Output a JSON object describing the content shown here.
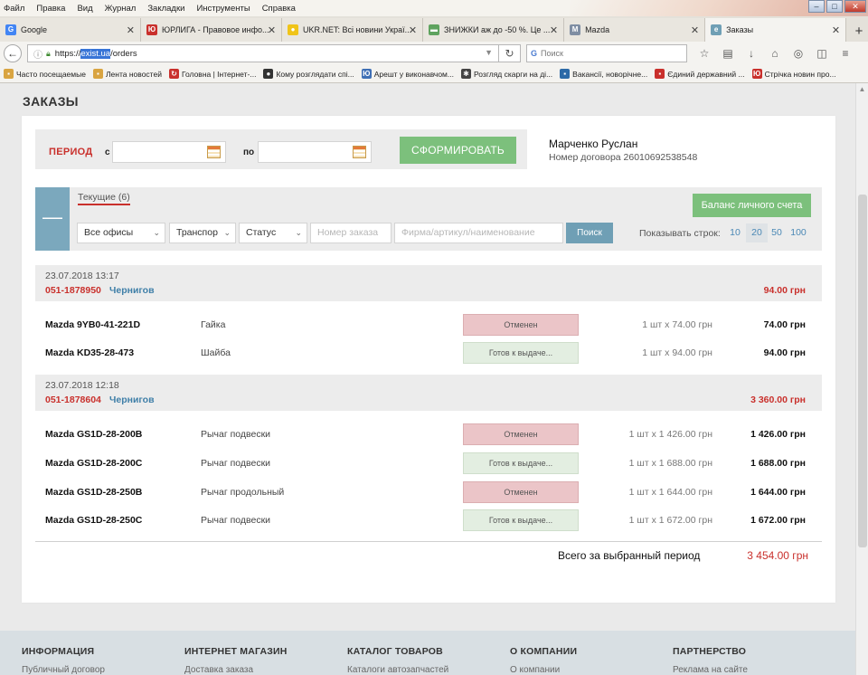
{
  "browser": {
    "menu": [
      "Файл",
      "Правка",
      "Вид",
      "Журнал",
      "Закладки",
      "Инструменты",
      "Справка"
    ],
    "tabs": [
      {
        "title": "Google",
        "icon": "google-icon",
        "color": "#4285f4"
      },
      {
        "title": "ЮРЛИГА - Правовое инфо...",
        "icon": "yurliga-icon",
        "color": "#c9302c"
      },
      {
        "title": "UKR.NET: Всі новини Украї...",
        "icon": "ukrnet-icon",
        "color": "#f0c419"
      },
      {
        "title": "ЗНИЖКИ аж до -50 %. Це ...",
        "icon": "sale-icon",
        "color": "#5fa35f"
      },
      {
        "title": "Mazda",
        "icon": "mazda-icon",
        "color": "#7f8ea3"
      },
      {
        "title": "Заказы",
        "icon": "exist-icon",
        "color": "#6f9fb5"
      }
    ],
    "url_prefix": "https://",
    "url_highlight": "exist.ua",
    "url_suffix": "/orders",
    "search_placeholder": "Поиск",
    "bookmarks": [
      {
        "label": "Часто посещаемые",
        "color": "#d9a441"
      },
      {
        "label": "Лента новостей",
        "color": "#d9a441"
      },
      {
        "label": "Головна | Інтернет-...",
        "color": "#c9302c"
      },
      {
        "label": "Кому розглядати спі...",
        "color": "#333333"
      },
      {
        "label": "Арешт у виконавчом...",
        "color": "#3f6fb5"
      },
      {
        "label": "Розгляд скарги на ді...",
        "color": "#444444"
      },
      {
        "label": "Вакансії, новорічне...",
        "color": "#2d6aa7"
      },
      {
        "label": "Єдиний державний ...",
        "color": "#c9302c"
      },
      {
        "label": "Стрічка новин про...",
        "color": "#c9302c"
      }
    ]
  },
  "page": {
    "title": "ЗАКАЗЫ",
    "period_label": "ПЕРИОД",
    "from_label": "с",
    "to_label": "по",
    "from_value": "",
    "to_value": "",
    "generate_button": "СФОРМИРОВАТЬ",
    "user_name": "Марченко Руслан",
    "contract": "Номер договора 26010692538548",
    "current_tab": "Текущие (6)",
    "balance_button": "Баланс личного счета",
    "filters": {
      "offices": "Все офисы",
      "transport": "Транспор",
      "status": "Статус",
      "order_placeholder": "Номер заказа",
      "article_placeholder": "Фирма/артикул/наименование",
      "search_button": "Поиск"
    },
    "rows_label": "Показывать строк:",
    "rows_options": [
      "10",
      "20",
      "50",
      "100"
    ],
    "rows_selected": "20",
    "orders": [
      {
        "date": "23.07.2018 13:17",
        "number": "051-1878950",
        "city": "Чернигов",
        "total": "94.00 грн",
        "items": [
          {
            "code": "Mazda 9YB0-41-221D",
            "name": "Гайка",
            "status": "Отменен",
            "status_type": "cancel",
            "qty": "1 шт x 74.00 грн",
            "sum": "74.00 грн"
          },
          {
            "code": "Mazda KD35-28-473",
            "name": "Шайба",
            "status": "Готов к выдаче...",
            "status_type": "ready",
            "qty": "1 шт x 94.00 грн",
            "sum": "94.00 грн"
          }
        ]
      },
      {
        "date": "23.07.2018 12:18",
        "number": "051-1878604",
        "city": "Чернигов",
        "total": "3 360.00 грн",
        "items": [
          {
            "code": "Mazda GS1D-28-200B",
            "name": "Рычаг подвески",
            "status": "Отменен",
            "status_type": "cancel",
            "qty": "1 шт x 1 426.00 грн",
            "sum": "1 426.00 грн"
          },
          {
            "code": "Mazda GS1D-28-200C",
            "name": "Рычаг подвески",
            "status": "Готов к выдаче...",
            "status_type": "ready",
            "qty": "1 шт x 1 688.00 грн",
            "sum": "1 688.00 грн"
          },
          {
            "code": "Mazda GS1D-28-250B",
            "name": "Рычаг продольный",
            "status": "Отменен",
            "status_type": "cancel",
            "qty": "1 шт x 1 644.00 грн",
            "sum": "1 644.00 грн"
          },
          {
            "code": "Mazda GS1D-28-250C",
            "name": "Рычаг подвески",
            "status": "Готов к выдаче...",
            "status_type": "ready",
            "qty": "1 шт x 1 672.00 грн",
            "sum": "1 672.00 грн"
          }
        ]
      }
    ],
    "total_label": "Всего за выбранный период",
    "total_value": "3 454.00 грн",
    "footer": [
      {
        "heading": "ИНФОРМАЦИЯ",
        "link": "Публичный договор"
      },
      {
        "heading": "ИНТЕРНЕТ МАГАЗИН",
        "link": "Доставка заказа"
      },
      {
        "heading": "КАТАЛОГ ТОВАРОВ",
        "link": "Каталоги автозапчастей"
      },
      {
        "heading": "О КОМПАНИИ",
        "link": "О компании"
      },
      {
        "heading": "ПАРТНЕРСТВО",
        "link": "Реклама на сайте"
      }
    ]
  },
  "colors": {
    "accent_red": "#c9302c",
    "accent_green": "#7cc07c",
    "accent_blue": "#6f9fb5",
    "status_cancel_bg": "#ebc5c8",
    "status_ready_bg": "#e3eee1"
  }
}
